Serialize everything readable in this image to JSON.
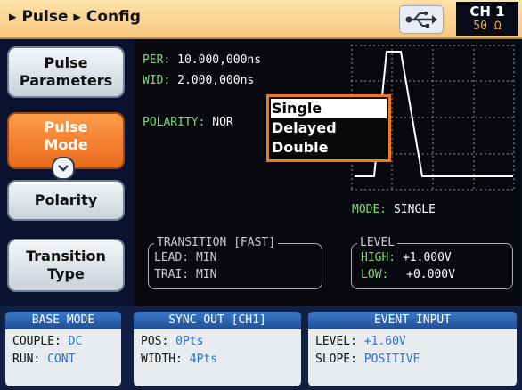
{
  "header": {
    "breadcrumb": "▸ Pulse ▸ Config",
    "channel": "CH 1",
    "impedance": "50 Ω"
  },
  "softkeys": [
    {
      "line1": "Pulse",
      "line2": "Parameters",
      "active": false
    },
    {
      "line1": "Pulse",
      "line2": "Mode",
      "active": true
    },
    {
      "line1": "Polarity",
      "line2": "",
      "active": false
    },
    {
      "line1": "Transition",
      "line2": "Type",
      "active": false
    }
  ],
  "params": {
    "per_label": "PER:",
    "per_value": "10.000,000ns",
    "wid_label": "WID:",
    "wid_value": "2.000,000ns",
    "polarity_label": "POLARITY:",
    "polarity_value": "NOR"
  },
  "mode_popup": {
    "options": [
      "Single",
      "Delayed",
      "Double"
    ],
    "selected": "Single"
  },
  "mode_status": {
    "label": "MODE:",
    "value": "SINGLE"
  },
  "transition": {
    "title": "TRANSITION [FAST]",
    "lead_label": "LEAD:",
    "lead_value": "MIN",
    "trail_label": "TRAI:",
    "trail_value": "MIN"
  },
  "level": {
    "title": "LEVEL",
    "high_label": "HIGH:",
    "high_value": "+1.000V",
    "low_label": "LOW:",
    "low_value": "+0.000V"
  },
  "base_mode": {
    "title": "BASE MODE",
    "couple_label": "COUPLE:",
    "couple_value": "DC",
    "run_label": "RUN:",
    "run_value": "CONT"
  },
  "sync_out": {
    "title": "SYNC OUT [CH1]",
    "pos_label": "POS:",
    "pos_value": "0Pts",
    "width_label": "WIDTH:",
    "width_value": "4Pts"
  },
  "event_input": {
    "title": "EVENT INPUT",
    "level_label": "LEVEL:",
    "level_value": "+1.60V",
    "slope_label": "SLOPE:",
    "slope_value": "POSITIVE"
  },
  "colors": {
    "accent": "#f07a21",
    "label_green": "#7dd87a",
    "title_bar": "#f8c780",
    "panel_blue": "#2c6fcf"
  }
}
